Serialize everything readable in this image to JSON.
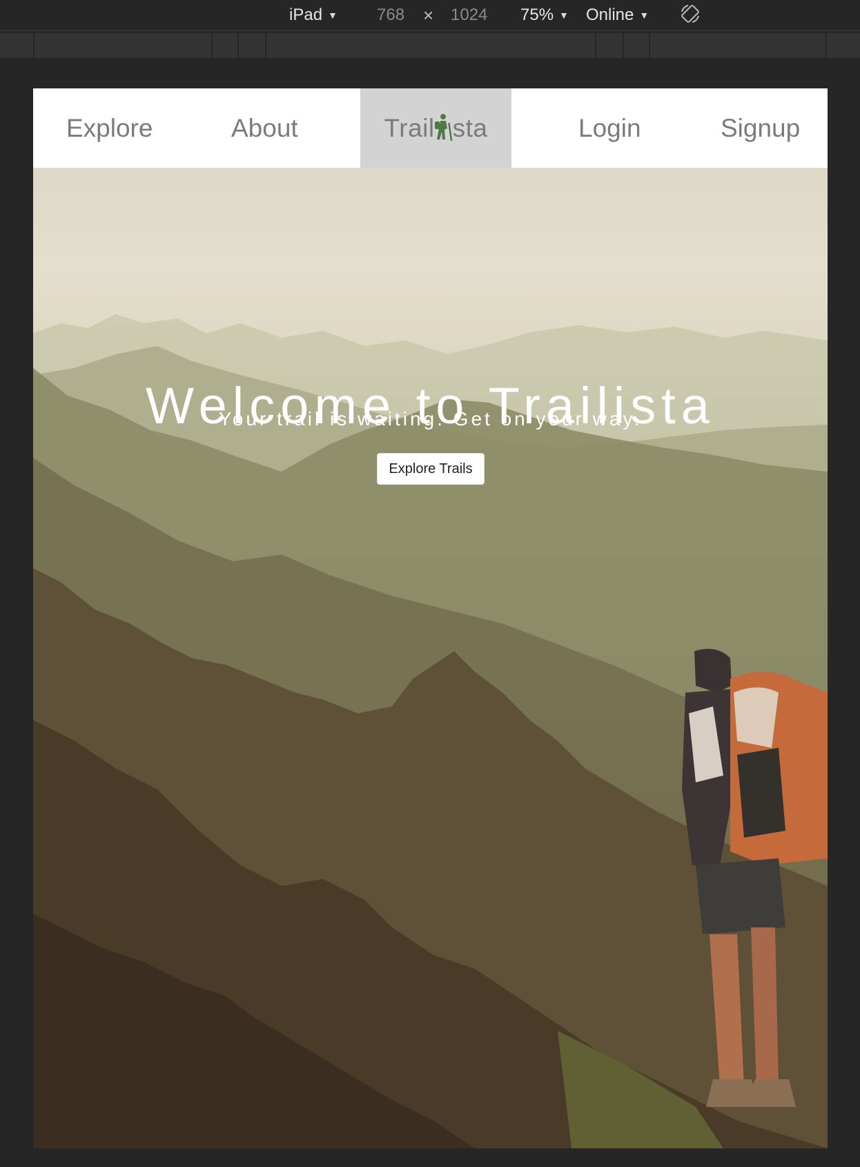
{
  "devtools": {
    "device": "iPad",
    "width": "768",
    "times": "×",
    "height": "1024",
    "zoom": "75%",
    "network": "Online",
    "rotate_icon": "rotate-icon"
  },
  "nav": {
    "explore": "Explore",
    "about": "About",
    "logo_left": "Trail",
    "logo_right": "sta",
    "logo_icon": "hiker-icon",
    "login": "Login",
    "signup": "Signup"
  },
  "hero": {
    "title": "Welcome to Trailista",
    "subtitle": "Your trail is waiting. Get on your way.",
    "button": "Explore Trails"
  },
  "colors": {
    "logo_icon": "#4f7a45",
    "logo_bg": "#d3d3d3",
    "nav_text": "#7b7b7b"
  }
}
